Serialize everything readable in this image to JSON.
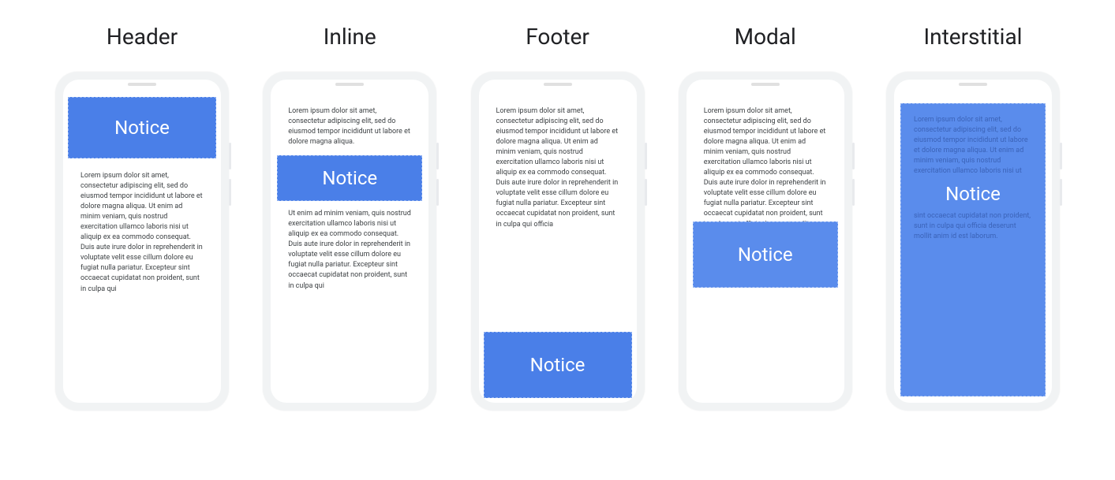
{
  "notice_label": "Notice",
  "lorem_a": "Lorem ipsum dolor sit amet, consectetur adipiscing elit, sed do eiusmod tempor incididunt ut labore et dolore magna aliqua. Ut enim ad minim veniam, quis nostrud exercitation ullamco laboris nisi ut aliquip ex ea commodo consequat. Duis aute irure dolor in reprehenderit in voluptate velit esse cillum dolore eu fugiat nulla pariatur. Excepteur sint occaecat cupidatat non proident, sunt in culpa qui",
  "lorem_b": "Lorem ipsum dolor sit amet, consectetur adipiscing elit, sed do eiusmod tempor incididunt ut labore et dolore magna aliqua.",
  "lorem_c": "Ut enim ad minim veniam, quis nostrud exercitation ullamco laboris nisi ut aliquip ex ea commodo consequat. Duis aute irure dolor in reprehenderit in voluptate velit esse cillum dolore eu fugiat nulla pariatur. Excepteur sint occaecat cupidatat non proident, sunt in culpa qui",
  "lorem_d": "Lorem ipsum dolor sit amet, consectetur adipiscing elit, sed do eiusmod tempor incididunt ut labore et dolore magna aliqua. Ut enim ad minim veniam, quis nostrud exercitation ullamco laboris nisi ut aliquip ex ea commodo consequat. Duis aute irure dolor in reprehenderit in voluptate velit esse cillum dolore eu fugiat nulla pariatur. Excepteur sint occaecat cupidatat non proident, sunt in culpa qui officia",
  "lorem_e": "Lorem ipsum dolor sit amet, consectetur adipiscing elit, sed do eiusmod tempor incididunt ut labore et dolore magna aliqua. Ut enim ad minim veniam, quis nostrud exercitation ullamco laboris nisi ut aliquip ex ea commodo consequat. Duis aute irure dolor in reprehenderit in voluptate velit esse cillum dolore eu fugiat nulla pariatur. Excepteur sint occaecat cupidatat non proident, sunt in culpa qui officia deserunt mollit anim id est laborum.",
  "lorem_top": "Lorem ipsum dolor sit amet, consectetur adipiscing elit, sed do eiusmod tempor incididunt ut labore et dolore magna aliqua. Ut enim ad minim veniam, quis nostrud exercitation ullamco laboris nisi ut",
  "lorem_bot": "sint occaecat cupidatat non proident, sunt in culpa qui officia deserunt mollit anim id est laborum.",
  "variants": {
    "header": {
      "title": "Header"
    },
    "inline": {
      "title": "Inline"
    },
    "footer": {
      "title": "Footer"
    },
    "modal": {
      "title": "Modal"
    },
    "interstitial": {
      "title": "Interstitial"
    }
  },
  "colors": {
    "notice_bg": "#4a7fe8",
    "overlay_bg": "#5a8cec",
    "text": "#3c4043",
    "phone_body": "#f1f3f4"
  }
}
